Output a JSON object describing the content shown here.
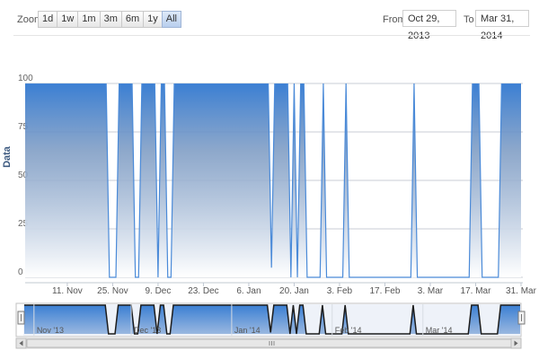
{
  "toolbar": {
    "zoom_label": "Zoom",
    "zoom_buttons": [
      "1d",
      "1w",
      "1m",
      "3m",
      "6m",
      "1y",
      "All"
    ],
    "active_zoom": "All",
    "from_label": "From",
    "from_value": "Oct 29, 2013",
    "to_label": "To",
    "to_value": "Mar 31, 2014"
  },
  "colors": {
    "series_top": "#3b7fd3",
    "series_bottom": "#ffffff",
    "line": "#4a8ad8",
    "navigator_line": "#1c1c1c"
  },
  "chart_data": {
    "type": "area",
    "ylabel": "Data",
    "ylim": [
      0,
      100
    ],
    "y_ticks": [
      "0",
      "25",
      "50",
      "75",
      "100"
    ],
    "grid": true,
    "x_range": [
      "2013-10-29",
      "2014-03-31"
    ],
    "x_tick_labels": [
      {
        "date": "2013-11-11",
        "label": "11. Nov"
      },
      {
        "date": "2013-11-25",
        "label": "25. Nov"
      },
      {
        "date": "2013-12-09",
        "label": "9. Dec"
      },
      {
        "date": "2013-12-23",
        "label": "23. Dec"
      },
      {
        "date": "2014-01-06",
        "label": "6. Jan"
      },
      {
        "date": "2014-01-20",
        "label": "20. Jan"
      },
      {
        "date": "2014-02-03",
        "label": "3. Feb"
      },
      {
        "date": "2014-02-17",
        "label": "17. Feb"
      },
      {
        "date": "2014-03-03",
        "label": "3. Mar"
      },
      {
        "date": "2014-03-17",
        "label": "17. Mar"
      },
      {
        "date": "2014-03-31",
        "label": "31. Mar"
      }
    ],
    "series": [
      {
        "points": [
          [
            "2013-10-29",
            100
          ],
          [
            "2013-11-23",
            100
          ],
          [
            "2013-11-24",
            0
          ],
          [
            "2013-11-26",
            0
          ],
          [
            "2013-11-27",
            100
          ],
          [
            "2013-12-01",
            100
          ],
          [
            "2013-12-02",
            0
          ],
          [
            "2013-12-03",
            0
          ],
          [
            "2013-12-04",
            100
          ],
          [
            "2013-12-08",
            100
          ],
          [
            "2013-12-09",
            0
          ],
          [
            "2013-12-10",
            100
          ],
          [
            "2013-12-11",
            100
          ],
          [
            "2013-12-12",
            0
          ],
          [
            "2013-12-13",
            0
          ],
          [
            "2013-12-14",
            100
          ],
          [
            "2014-01-12",
            100
          ],
          [
            "2014-01-13",
            5
          ],
          [
            "2014-01-14",
            100
          ],
          [
            "2014-01-18",
            100
          ],
          [
            "2014-01-19",
            0
          ],
          [
            "2014-01-20",
            100
          ],
          [
            "2014-01-21",
            0
          ],
          [
            "2014-01-22",
            100
          ],
          [
            "2014-01-23",
            100
          ],
          [
            "2014-01-24",
            0
          ],
          [
            "2014-01-28",
            0
          ],
          [
            "2014-01-29",
            100
          ],
          [
            "2014-01-30",
            0
          ],
          [
            "2014-02-04",
            0
          ],
          [
            "2014-02-05",
            100
          ],
          [
            "2014-02-06",
            0
          ],
          [
            "2014-02-25",
            0
          ],
          [
            "2014-02-26",
            100
          ],
          [
            "2014-02-27",
            0
          ],
          [
            "2014-03-15",
            0
          ],
          [
            "2014-03-16",
            100
          ],
          [
            "2014-03-18",
            100
          ],
          [
            "2014-03-19",
            0
          ],
          [
            "2014-03-24",
            0
          ],
          [
            "2014-03-25",
            100
          ],
          [
            "2014-03-31",
            100
          ]
        ]
      }
    ],
    "navigator": {
      "labels": [
        {
          "date": "2013-11-01",
          "label": "Nov '13"
        },
        {
          "date": "2013-12-01",
          "label": "Dec '13"
        },
        {
          "date": "2014-01-01",
          "label": "Jan '14"
        },
        {
          "date": "2014-02-01",
          "label": "Feb '14"
        },
        {
          "date": "2014-03-01",
          "label": "Mar '14"
        }
      ]
    }
  }
}
